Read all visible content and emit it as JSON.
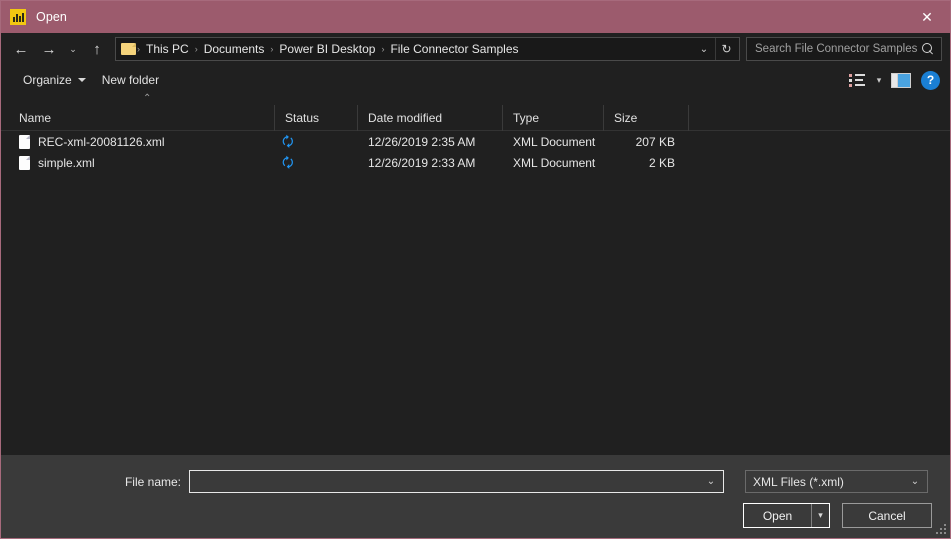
{
  "window": {
    "title": "Open",
    "app_icon": "power-bi-icon",
    "close_label": "✕",
    "titlebar_color": "#9C5B6D"
  },
  "nav": {
    "back": "←",
    "forward": "→",
    "recent": "⌄",
    "up": "↑",
    "breadcrumbs": [
      "This PC",
      "Documents",
      "Power BI Desktop",
      "File Connector Samples"
    ],
    "separator": "›",
    "dropdown": "⌄",
    "refresh": "↻"
  },
  "search": {
    "placeholder": "Search File Connector Samples",
    "value": "",
    "icon": "search-icon"
  },
  "toolbar": {
    "organize_label": "Organize",
    "new_folder_label": "New folder",
    "view_icon": "view-list-icon",
    "view_caret": "▾",
    "preview_pane_icon": "preview-pane-icon",
    "help_label": "?"
  },
  "columns": {
    "sort_indicator": "⌃",
    "headers": [
      "Name",
      "Status",
      "Date modified",
      "Type",
      "Size"
    ]
  },
  "files": [
    {
      "name": "REC-xml-20081126.xml",
      "status_icon": "sync-icon",
      "date_modified": "12/26/2019 2:35 AM",
      "type": "XML Document",
      "size": "207 KB"
    },
    {
      "name": "simple.xml",
      "status_icon": "sync-icon",
      "date_modified": "12/26/2019 2:33 AM",
      "type": "XML Document",
      "size": "2 KB"
    }
  ],
  "footer": {
    "file_name_label": "File name:",
    "file_name_value": "",
    "file_name_placeholder": "",
    "file_type_value": "XML Files (*.xml)",
    "combo_caret": "⌄",
    "open_label": "Open",
    "open_split_caret": "▾",
    "cancel_label": "Cancel"
  }
}
